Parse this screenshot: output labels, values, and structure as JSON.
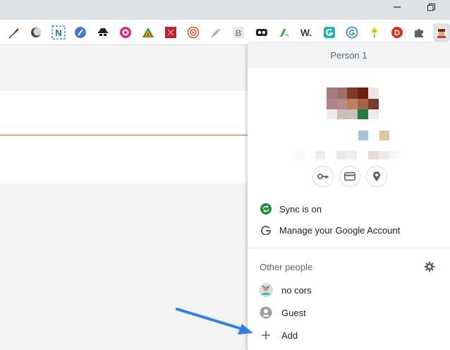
{
  "window": {
    "minimize_icon": "minimize-icon",
    "restore_icon": "restore-icon"
  },
  "toolbar": {
    "extensions": [
      {
        "name": "quill-extension-icon",
        "color": "#7a3b1f"
      },
      {
        "name": "moon-extension-icon",
        "color": "#555555"
      },
      {
        "name": "n-extension-icon",
        "color": "#1f6fb5",
        "text": "N"
      },
      {
        "name": "blue-circle-extension-icon",
        "color": "#4a78c4"
      },
      {
        "name": "spy-extension-icon",
        "color": "#222222"
      },
      {
        "name": "pink-eye-extension-icon",
        "color": "#e2267f"
      },
      {
        "name": "rainbow-triangle-extension-icon",
        "color": "#2a8d3d"
      },
      {
        "name": "red-square-extension-icon",
        "color": "#b8232d"
      },
      {
        "name": "target-extension-icon",
        "color": "#d5572c"
      },
      {
        "name": "feather-extension-icon",
        "color": "#9e9e9e"
      },
      {
        "name": "b-extension-icon",
        "color": "#9e9e9e",
        "text": "B"
      },
      {
        "name": "mask-extension-icon",
        "color": "#222222"
      },
      {
        "name": "green-k-extension-icon",
        "color": "#2e9f3e"
      },
      {
        "name": "w-extension-icon",
        "color": "#3b3b3b",
        "text": "W."
      },
      {
        "name": "teal-g-extension-icon",
        "color": "#20b5a6"
      },
      {
        "name": "g-circle-extension-icon",
        "color": "#4285f4"
      },
      {
        "name": "diamond-extension-icon",
        "color": "#c8b82a"
      },
      {
        "name": "d-extension-icon",
        "color": "#d93025",
        "text": "D"
      },
      {
        "name": "puzzle-icon",
        "color": "#5f6368"
      }
    ]
  },
  "profile_menu": {
    "header": "Person 1",
    "actions": {
      "passwords_icon": "key-icon",
      "payments_icon": "credit-card-icon",
      "addresses_icon": "location-pin-icon"
    },
    "sync_label": "Sync is on",
    "manage_label": "Manage your Google Account",
    "other_people_label": "Other people",
    "people": [
      {
        "label": "no cors"
      },
      {
        "label": "Guest"
      },
      {
        "label": "Add"
      }
    ],
    "colors": {
      "sync_green": "#1e8e3e",
      "arrow_blue": "#2f7ff0"
    }
  }
}
